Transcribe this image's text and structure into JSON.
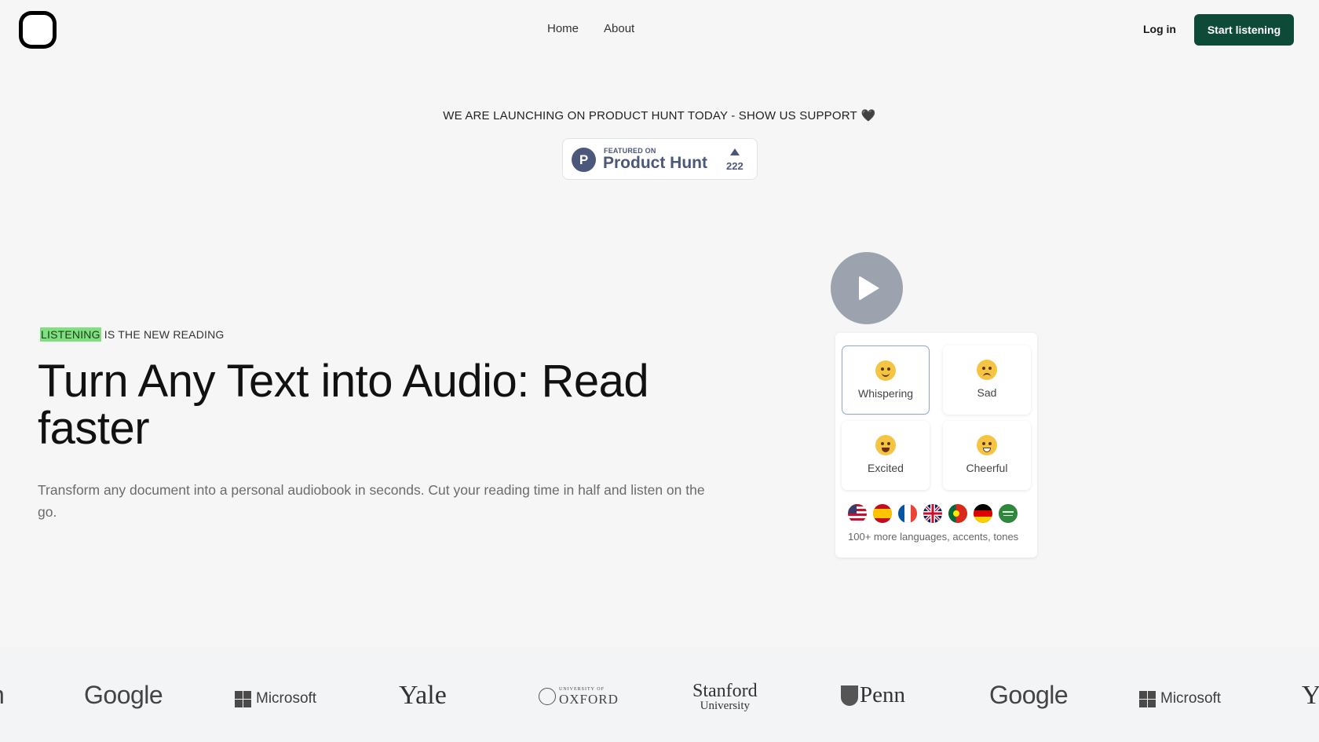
{
  "header": {
    "nav": [
      "Home",
      "About"
    ],
    "login_label": "Log in",
    "cta_label": "Start listening"
  },
  "launch": {
    "text": "WE ARE LAUNCHING ON PRODUCT HUNT TODAY - SHOW US SUPPORT",
    "heart": "🖤",
    "badge": {
      "featured_on": "FEATURED ON",
      "name": "Product Hunt",
      "upvotes": "222",
      "logo_letter": "P"
    }
  },
  "hero": {
    "kicker_highlight": "LISTENING",
    "kicker_rest": " IS THE NEW READING",
    "title": "Turn Any Text into Audio: Read faster",
    "subtitle": "Transform any document into a personal audiobook in seconds. Cut your reading time in half and listen on the go."
  },
  "demo": {
    "tones": [
      {
        "label": "Whispering",
        "icon": "shushing-face-icon",
        "selected": true
      },
      {
        "label": "Sad",
        "icon": "crying-face-icon",
        "selected": false
      },
      {
        "label": "Excited",
        "icon": "star-struck-face-icon",
        "selected": false
      },
      {
        "label": "Cheerful",
        "icon": "grinning-face-icon",
        "selected": false
      }
    ],
    "flags": [
      "us-flag-icon",
      "spain-flag-icon",
      "france-flag-icon",
      "uk-flag-icon",
      "portugal-flag-icon",
      "germany-flag-icon",
      "saudi-arabia-flag-icon"
    ],
    "more_languages": "100+ more languages, accents, tones"
  },
  "logos": {
    "partial_left": "n",
    "google": "Google",
    "microsoft": "Microsoft",
    "yale": "Yale",
    "oxford_small": "UNIVERSITY OF",
    "oxford_big": "OXFORD",
    "stanford_1": "Stanford",
    "stanford_2": "University",
    "penn": "Penn",
    "partial_right": "Y"
  },
  "colors": {
    "cta_bg": "#0d4a37",
    "highlight": "#7fe07f",
    "product_hunt": "#4b587c",
    "play_button": "#9ca3af"
  }
}
